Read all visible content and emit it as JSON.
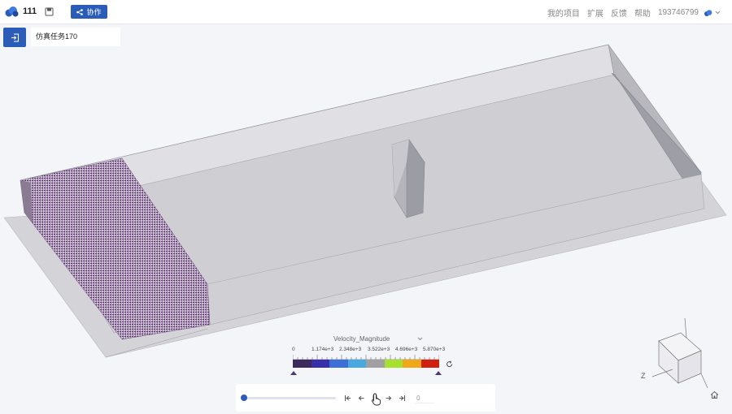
{
  "header": {
    "project_name": "111",
    "share_label": "协作",
    "nav": [
      "我的项目",
      "扩展",
      "反馈",
      "帮助"
    ],
    "user": "193746799"
  },
  "task": {
    "name": "仿真任务170"
  },
  "legend": {
    "field": "Velocity_Magnitude",
    "ticks": [
      "0",
      "1.174e+3",
      "2.348e+3",
      "3.522e+3",
      "4.696e+3",
      "5.870e+3"
    ],
    "colors": [
      "#3b2a5a",
      "#3a2faa",
      "#3d6fd8",
      "#4aa8e0",
      "#a0a0a0",
      "#a8e030",
      "#f0a818",
      "#d02010"
    ]
  },
  "player": {
    "frame": "0",
    "progress": 0.0
  },
  "axes": {
    "labels": [
      "Z"
    ]
  },
  "colors": {
    "accent": "#2a5cb8",
    "particles": "#5a2e6a"
  }
}
